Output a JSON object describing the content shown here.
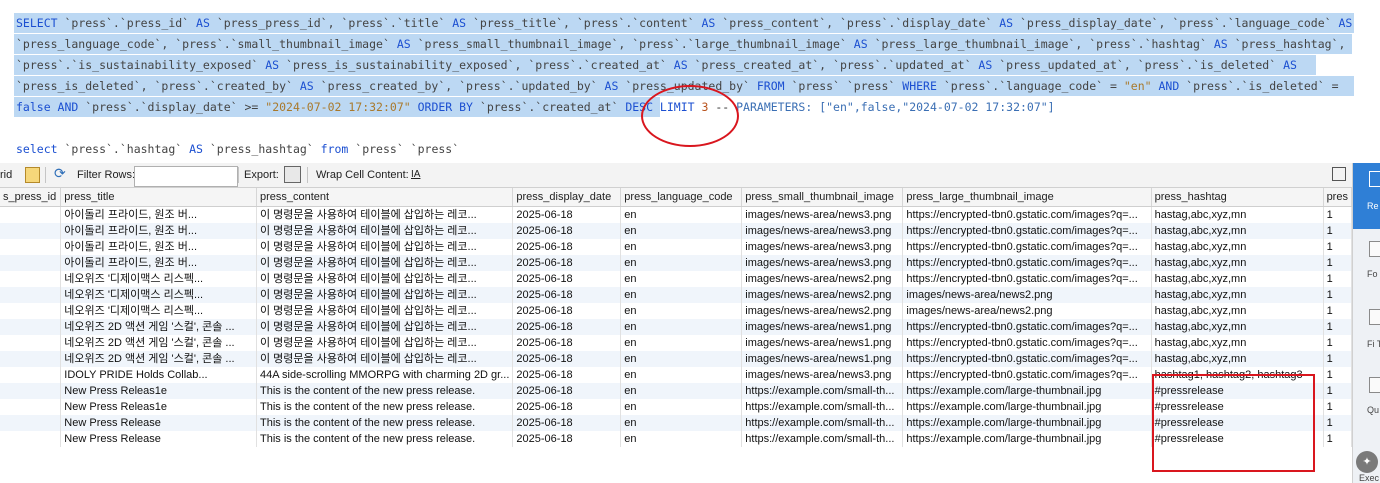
{
  "sql": {
    "lines": [
      [
        [
          "kw",
          "SELECT "
        ],
        [
          "id",
          "`press`.`press_id` "
        ],
        [
          "kw",
          "AS "
        ],
        [
          "id",
          "`press_press_id`, `press`.`title` "
        ],
        [
          "kw",
          "AS "
        ],
        [
          "id",
          "`press_title`, `press`.`content` "
        ],
        [
          "kw",
          "AS "
        ],
        [
          "id",
          "`press_content`, `press`.`display_date` "
        ],
        [
          "kw",
          "AS "
        ],
        [
          "id",
          "`press_display_date`, `press`.`language_code` "
        ],
        [
          "kw",
          "AS"
        ]
      ],
      [
        [
          "id",
          "`press_language_code`, `press`.`small_thumbnail_image` "
        ],
        [
          "kw",
          "AS "
        ],
        [
          "id",
          "`press_small_thumbnail_image`, `press`.`large_thumbnail_image` "
        ],
        [
          "kw",
          "AS "
        ],
        [
          "id",
          "`press_large_thumbnail_image`, `press`.`hashtag` "
        ],
        [
          "kw",
          "AS "
        ],
        [
          "id",
          "`press_hashtag`,"
        ]
      ],
      [
        [
          "id",
          "`press`.`is_sustainability_exposed` "
        ],
        [
          "kw",
          "AS "
        ],
        [
          "id",
          "`press_is_sustainability_exposed`, `press`.`created_at` "
        ],
        [
          "kw",
          "AS "
        ],
        [
          "id",
          "`press_created_at`, `press`.`updated_at` "
        ],
        [
          "kw",
          "AS "
        ],
        [
          "id",
          "`press_updated_at`, `press`.`is_deleted` "
        ],
        [
          "kw",
          "AS"
        ]
      ],
      [
        [
          "id",
          "`press_is_deleted`, `press`.`created_by` "
        ],
        [
          "kw",
          "AS "
        ],
        [
          "id",
          "`press_created_by`, `press`.`updated_by` "
        ],
        [
          "kw",
          "AS "
        ],
        [
          "id",
          "`press_updated_by` "
        ],
        [
          "kw",
          "FROM "
        ],
        [
          "id",
          "`press` `press` "
        ],
        [
          "kw",
          "WHERE "
        ],
        [
          "id",
          "`press`.`language_code` = "
        ],
        [
          "str",
          "\"en\" "
        ],
        [
          "kw",
          "AND "
        ],
        [
          "id",
          "`press`.`is_deleted` ="
        ]
      ],
      [
        [
          "kw",
          "false AND "
        ],
        [
          "id",
          "`press`.`display_date` >= "
        ],
        [
          "str",
          "\"2024-07-02 17:32:07\" "
        ],
        [
          "kw",
          "ORDER BY "
        ],
        [
          "id",
          "`press`.`created_at` "
        ],
        [
          "kw",
          "DESC LIMIT "
        ],
        [
          "num",
          "3 "
        ],
        [
          "plain",
          "-- "
        ],
        [
          "params",
          "PARAMETERS: [\"en\",false,\"2024-07-02 17:32:07\"]"
        ]
      ]
    ],
    "select2": [
      [
        "kw",
        "select "
      ],
      [
        "id",
        "`press`.`hashtag` "
      ],
      [
        "kw",
        "AS "
      ],
      [
        "id",
        "`press_hashtag` "
      ],
      [
        "kw",
        "from "
      ],
      [
        "id",
        "`press` `press`"
      ]
    ]
  },
  "toolbar": {
    "grid_label": "rid",
    "filter_label": "Filter Rows:",
    "filter_value": "",
    "export_label": "Export:",
    "wrap_label": "Wrap Cell Content:",
    "wrap_icon_text": "IA"
  },
  "right_panel": [
    "Re G",
    "Fo Ed",
    "Fi Ty",
    "Qu St",
    "Exec"
  ],
  "table": {
    "columns": [
      "s_press_id",
      "press_title",
      "press_content",
      "press_display_date",
      "press_language_code",
      "press_small_thumbnail_image",
      "press_large_thumbnail_image",
      "press_hashtag",
      "pres"
    ],
    "rows": [
      [
        "",
        "아이돌리 프라이드, 원조 버...",
        "이 명령문을 사용하여 테이블에 삽입하는 레코...",
        "2025-06-18",
        "en",
        "images/news-area/news3.png",
        "https://encrypted-tbn0.gstatic.com/images?q=...",
        "hastag,abc,xyz,mn",
        "1"
      ],
      [
        "",
        "아이돌리 프라이드, 원조 버...",
        "이 명령문을 사용하여 테이블에 삽입하는 레코...",
        "2025-06-18",
        "en",
        "images/news-area/news3.png",
        "https://encrypted-tbn0.gstatic.com/images?q=...",
        "hastag,abc,xyz,mn",
        "1"
      ],
      [
        "",
        "아이돌리 프라이드, 원조 버...",
        "이 명령문을 사용하여 테이블에 삽입하는 레코...",
        "2025-06-18",
        "en",
        "images/news-area/news3.png",
        "https://encrypted-tbn0.gstatic.com/images?q=...",
        "hastag,abc,xyz,mn",
        "1"
      ],
      [
        "",
        "아이돌리 프라이드, 원조 버...",
        "이 명령문을 사용하여 테이블에 삽입하는 레코...",
        "2025-06-18",
        "en",
        "images/news-area/news3.png",
        "https://encrypted-tbn0.gstatic.com/images?q=...",
        "hastag,abc,xyz,mn",
        "1"
      ],
      [
        "",
        "네오위즈 '디제이맥스 리스펙...",
        "이 명령문을 사용하여 테이블에 삽입하는 레코...",
        "2025-06-18",
        "en",
        "images/news-area/news2.png",
        "https://encrypted-tbn0.gstatic.com/images?q=...",
        "hastag,abc,xyz,mn",
        "1"
      ],
      [
        "",
        "네오위즈 '디제이맥스 리스펙...",
        "이 명령문을 사용하여 테이블에 삽입하는 레코...",
        "2025-06-18",
        "en",
        "images/news-area/news2.png",
        "images/news-area/news2.png",
        "hastag,abc,xyz,mn",
        "1"
      ],
      [
        "",
        "네오위즈 '디제이맥스 리스펙...",
        "이 명령문을 사용하여 테이블에 삽입하는 레코...",
        "2025-06-18",
        "en",
        "images/news-area/news2.png",
        "images/news-area/news2.png",
        "hastag,abc,xyz,mn",
        "1"
      ],
      [
        "",
        "네오위즈 2D 액션 게임 '스컬', 콘솔 ...",
        "이 명령문을 사용하여 테이블에 삽입하는 레코...",
        "2025-06-18",
        "en",
        "images/news-area/news1.png",
        "https://encrypted-tbn0.gstatic.com/images?q=...",
        "hastag,abc,xyz,mn",
        "1"
      ],
      [
        "",
        "네오위즈 2D 액션 게임 '스컬', 콘솔 ...",
        "이 명령문을 사용하여 테이블에 삽입하는 레코...",
        "2025-06-18",
        "en",
        "images/news-area/news1.png",
        "https://encrypted-tbn0.gstatic.com/images?q=...",
        "hastag,abc,xyz,mn",
        "1"
      ],
      [
        "",
        "네오위즈 2D 액션 게임 '스컬', 콘솔 ...",
        "이 명령문을 사용하여 테이블에 삽입하는 레코...",
        "2025-06-18",
        "en",
        "images/news-area/news1.png",
        "https://encrypted-tbn0.gstatic.com/images?q=...",
        "hastag,abc,xyz,mn",
        "1"
      ],
      [
        "",
        "IDOLY PRIDE Holds Collab...",
        "44A side-scrolling MMORPG with charming 2D gr...",
        "2025-06-18",
        "en",
        "images/news-area/news3.png",
        "https://encrypted-tbn0.gstatic.com/images?q=...",
        "hashtag1, hashtag2, hashtag3",
        "1"
      ],
      [
        "",
        "New Press Releas1e",
        "This is the content of the new press release.",
        "2025-06-18",
        "en",
        "https://example.com/small-th...",
        "https://example.com/large-thumbnail.jpg",
        "#pressrelease",
        "1"
      ],
      [
        "",
        "New Press Releas1e",
        "This is the content of the new press release.",
        "2025-06-18",
        "en",
        "https://example.com/small-th...",
        "https://example.com/large-thumbnail.jpg",
        "#pressrelease",
        "1"
      ],
      [
        "",
        "New Press Release",
        "This is the content of the new press release.",
        "2025-06-18",
        "en",
        "https://example.com/small-th...",
        "https://example.com/large-thumbnail.jpg",
        "#pressrelease",
        "1"
      ],
      [
        "",
        "New Press Release",
        "This is the content of the new press release.",
        "2025-06-18",
        "en",
        "https://example.com/small-th...",
        "https://example.com/large-thumbnail.jpg",
        "#pressrelease",
        "1"
      ]
    ]
  }
}
